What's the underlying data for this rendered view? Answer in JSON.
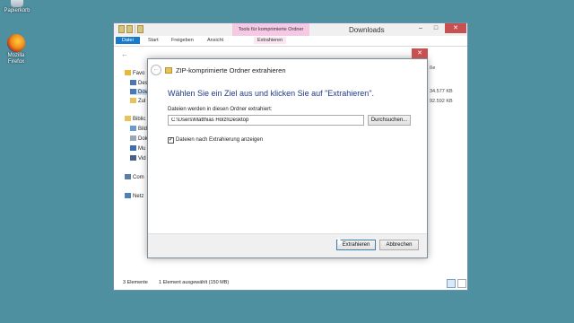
{
  "desktop": {
    "recycle_bin": "Papierkorb",
    "firefox_line1": "Mozilla",
    "firefox_line2": "Firefox"
  },
  "explorer": {
    "context_tab_title": "Tools für komprimierte Ordner",
    "window_title": "Downloads",
    "controls": {
      "minimize": "–",
      "maximize": "□",
      "close": "✕"
    },
    "ribbon_tabs": [
      "Datei",
      "Start",
      "Freigeben",
      "Ansicht",
      "Extrahieren"
    ],
    "nav_items": [
      "Favo",
      "Des",
      "Dov",
      "Zul",
      "Biblic",
      "Bild",
      "Dok",
      "Mu",
      "Vid",
      "Com",
      "Netz"
    ],
    "right_header": "ße",
    "right_sizes": [
      "34.577 KB",
      "92.592 KB"
    ],
    "status_items": "3 Elemente",
    "status_selection": "1 Element ausgewählt (150 MB)"
  },
  "dialog": {
    "title": "ZIP-komprimierte Ordner extrahieren",
    "close": "✕",
    "heading": "Wählen Sie ein Ziel aus und klicken Sie auf \"Extrahieren\".",
    "path_label": "Dateien werden in diesen Ordner extrahiert:",
    "path_value": "C:\\Users\\Matthias Hölzl\\Desktop",
    "browse_button": "Durchsuchen...",
    "show_files_label": "Dateien nach Extrahierung anzeigen",
    "show_files_checked": true,
    "extract_button": "Extrahieren",
    "cancel_button": "Abbrechen"
  },
  "colors": {
    "desktop": "#4e8fa0",
    "ribbon_file_tab": "#1979ca",
    "context_tab": "#f5c9e4",
    "heading_text": "#1e3b87",
    "close_button": "#c75050"
  }
}
